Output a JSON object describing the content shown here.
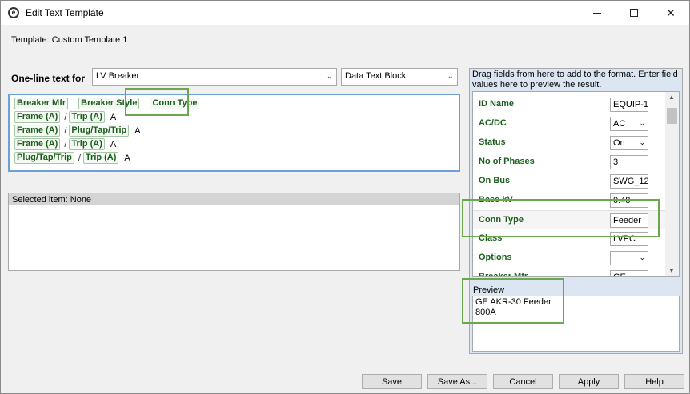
{
  "window": {
    "title": "Edit Text Template",
    "minimize": "—",
    "close": "✕"
  },
  "template": {
    "label": "Template:",
    "name": "Custom Template 1"
  },
  "one_line": {
    "label": "One-line text for",
    "device_combo": "LV Breaker",
    "block_combo": "Data Text Block"
  },
  "format_lines": [
    {
      "parts": [
        {
          "chip": "Breaker Mfr"
        },
        {
          "chip": "Breaker Style"
        },
        {
          "chip": "Conn Type"
        }
      ]
    },
    {
      "parts": [
        {
          "chip": "Frame (A)"
        },
        {
          "sep": "/"
        },
        {
          "chip": "Trip (A)"
        },
        {
          "unit": "A"
        }
      ]
    },
    {
      "parts": [
        {
          "chip": "Frame (A)"
        },
        {
          "sep": "/"
        },
        {
          "chip": "Plug/Tap/Trip"
        },
        {
          "unit": "A"
        }
      ]
    },
    {
      "parts": [
        {
          "chip": "Frame (A)"
        },
        {
          "sep": "/"
        },
        {
          "chip": "Trip (A)"
        },
        {
          "unit": "A"
        }
      ]
    },
    {
      "parts": [
        {
          "chip": "Plug/Tap/Trip"
        },
        {
          "sep": "/"
        },
        {
          "chip": "Trip (A)"
        },
        {
          "unit": "A"
        }
      ]
    }
  ],
  "selected_item": "Selected item: None",
  "fields_panel": {
    "instructions": "Drag fields from here to add to the format.  Enter field values here to preview the result.",
    "fields": [
      {
        "label": "ID Name",
        "value": "EQUIP-1",
        "dropdown": false
      },
      {
        "label": "AC/DC",
        "value": "AC",
        "dropdown": true
      },
      {
        "label": "Status",
        "value": "On",
        "dropdown": true
      },
      {
        "label": "No of Phases",
        "value": "3",
        "dropdown": false
      },
      {
        "label": "On Bus",
        "value": "SWG_12",
        "dropdown": false
      },
      {
        "label": "Base kV",
        "value": "0.48",
        "dropdown": false
      },
      {
        "label": "Conn Type",
        "value": "Feeder",
        "dropdown": false
      },
      {
        "label": "Class",
        "value": "LVPC",
        "dropdown": false
      },
      {
        "label": "Options",
        "value": "",
        "dropdown": true
      },
      {
        "label": "Breaker Mfr",
        "value": "GE",
        "dropdown": false
      }
    ],
    "arrow_down": "⌄",
    "scroll_up": "▲",
    "scroll_down": "▼"
  },
  "preview": {
    "label": "Preview",
    "line1": "GE  AKR-30 Feeder",
    "line2": "800A"
  },
  "buttons": {
    "save": "Save",
    "save_as": "Save As...",
    "cancel": "Cancel",
    "apply": "Apply",
    "help": "Help"
  },
  "colors": {
    "field_green": "#1c5e1c",
    "highlight_green": "#6aa84f",
    "format_border": "#6da0d3",
    "panel_bg": "#dce6f2"
  }
}
